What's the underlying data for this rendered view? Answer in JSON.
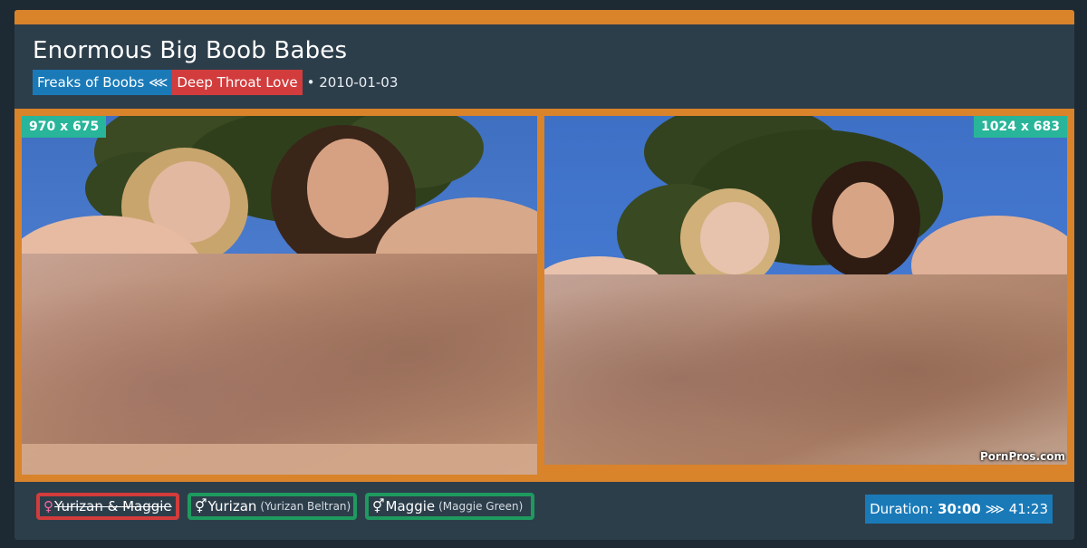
{
  "scene": {
    "title": "Enormous Big Boob Babes",
    "series_label": "Freaks of Boobs ⋘",
    "site_label": "Deep Throat Love",
    "date_text": "• 2010-01-03"
  },
  "images": [
    {
      "dimensions": "970 x 675"
    },
    {
      "dimensions": "1024 x 683",
      "watermark": "PornPros.com"
    }
  ],
  "performers": [
    {
      "symbol": "♀",
      "name": "Yurizan & Maggie",
      "alias": "",
      "status": "struck"
    },
    {
      "symbol": "⚥",
      "name": "Yurizan",
      "alias": "(Yurizan Beltran)",
      "status": "ok"
    },
    {
      "symbol": "⚥",
      "name": "Maggie",
      "alias": "(Maggie Green)",
      "status": "ok"
    }
  ],
  "duration": {
    "label": "Duration:",
    "value": "30:00",
    "separator": "⋙",
    "alt_value": "41:23"
  },
  "colors": {
    "accent_orange": "#d9832b",
    "panel": "#2d3e4b",
    "blue_tag": "#1a7ab8",
    "red_tag": "#d23c3c",
    "green_border": "#1f9a5f",
    "teal_badge": "#28b59a"
  }
}
